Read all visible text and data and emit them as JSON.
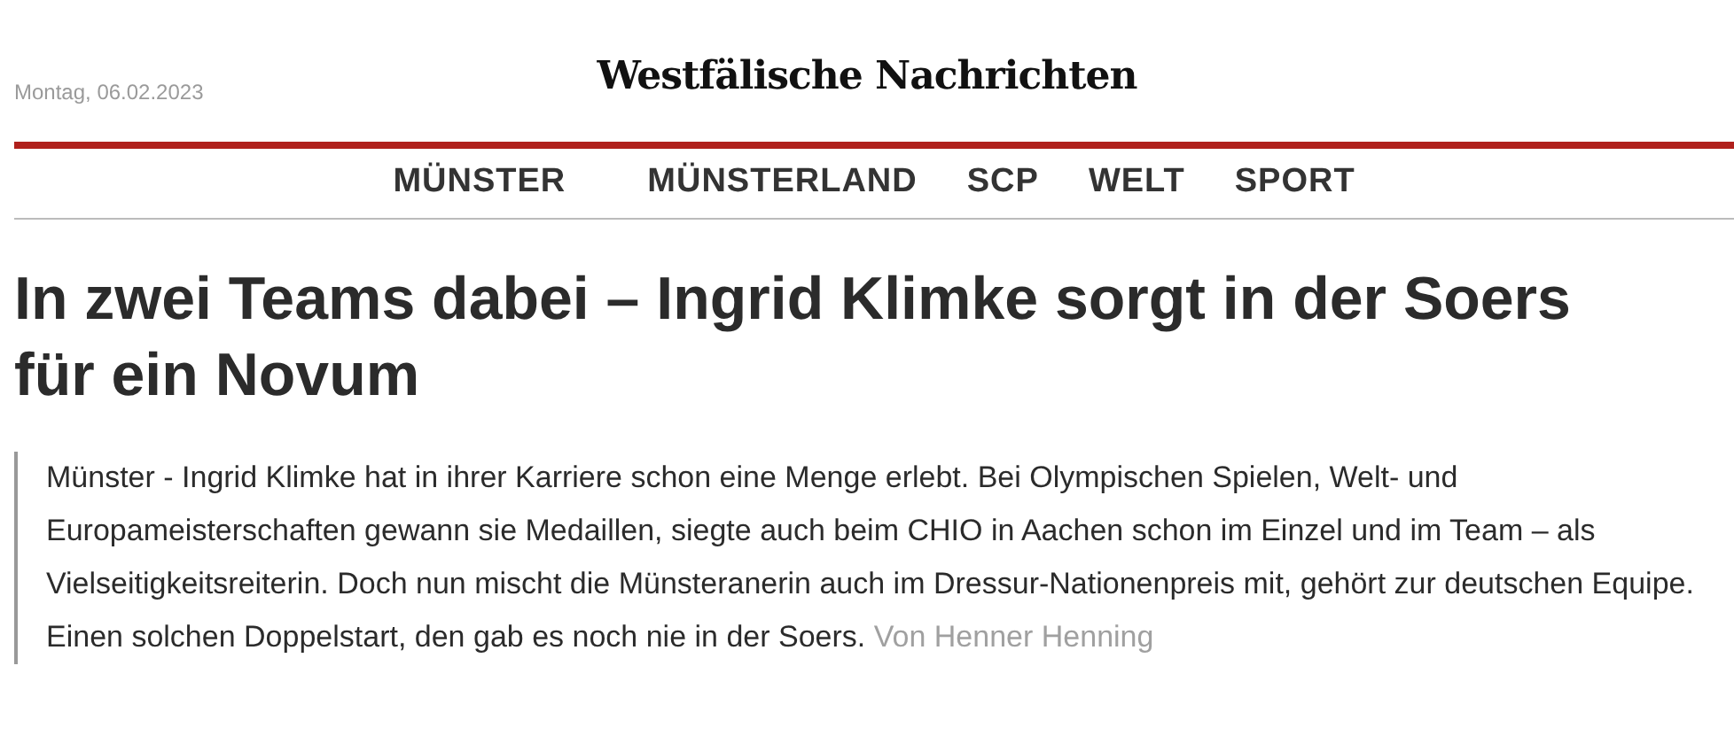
{
  "header": {
    "date": "Montag, 06.02.2023",
    "logo": "Westfälische Nachrichten"
  },
  "nav": [
    {
      "label": "MÜNSTER"
    },
    {
      "label": "MÜNSTERLAND"
    },
    {
      "label": "SCP"
    },
    {
      "label": "WELT"
    },
    {
      "label": "SPORT"
    }
  ],
  "article": {
    "headline": "In zwei Teams dabei – Ingrid Klimke sorgt in der Soers für ein Novum",
    "lead": "Münster - Ingrid Klimke hat in ihrer Karriere schon eine Menge erlebt. Bei Olympischen Spielen, Welt- und Europameisterschaften gewann sie Medaillen, siegte auch beim CHIO in Aachen schon im Einzel und im Team – als Vielseitigkeitsreiterin. Doch nun mischt die Münsteranerin auch im Dressur-Nationenpreis mit, gehört zur deutschen Equipe. Einen solchen Doppelstart, den gab es noch nie in der Soers.",
    "byline": "Von Henner Henning"
  }
}
